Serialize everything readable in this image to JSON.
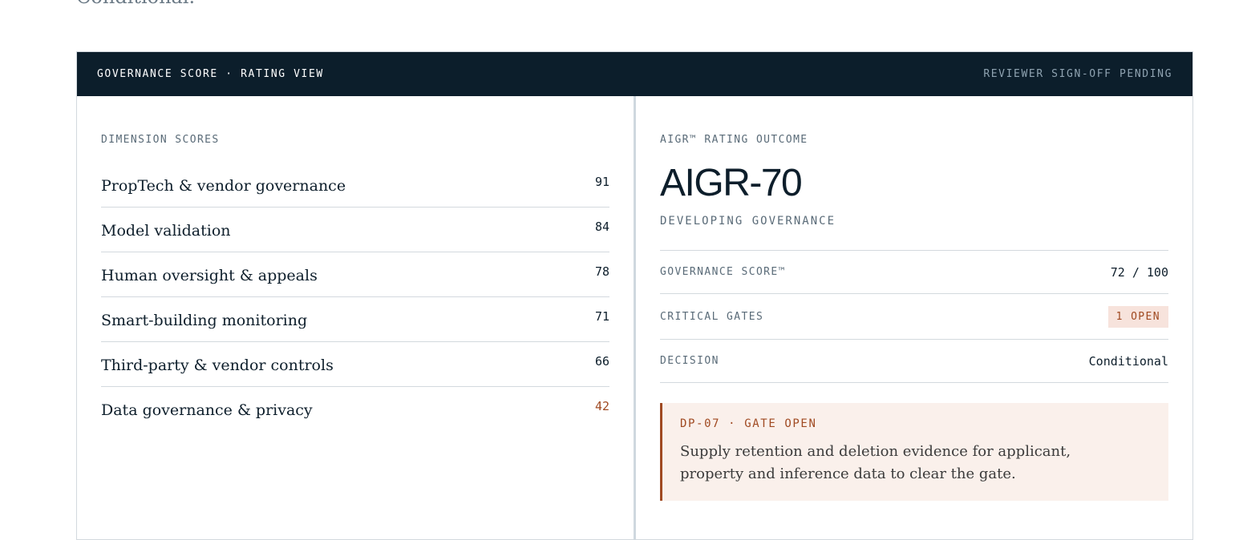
{
  "previous": {
    "text": "Conditional."
  },
  "header": {
    "title": "GOVERNANCE SCORE · RATING VIEW",
    "status": "REVIEWER SIGN-OFF PENDING"
  },
  "dimensions": {
    "heading": "DIMENSION SCORES",
    "items": [
      {
        "label": "PropTech & vendor governance",
        "score": "91"
      },
      {
        "label": "Model validation",
        "score": "84"
      },
      {
        "label": "Human oversight & appeals",
        "score": "78"
      },
      {
        "label": "Smart-building monitoring",
        "score": "71"
      },
      {
        "label": "Third-party & vendor controls",
        "score": "66"
      },
      {
        "label": "Data governance & privacy",
        "score": "42"
      }
    ]
  },
  "outcome": {
    "heading": "AIGR™ RATING OUTCOME",
    "rating": "AIGR-70",
    "level": "DEVELOPING GOVERNANCE",
    "rows": [
      {
        "key": "GOVERNANCE SCORE™",
        "value": "72 / 100"
      },
      {
        "key": "CRITICAL GATES",
        "value": "1 OPEN"
      },
      {
        "key": "DECISION",
        "value": "Conditional"
      }
    ],
    "alert": {
      "title": "DP-07 · GATE OPEN",
      "body": "Supply retention and deletion evidence for applicant, property and inference data to clear the gate."
    }
  },
  "colors": {
    "header_bg": "#0c1e2b",
    "accent_warning": "#a04a22",
    "pill_bg": "#f7e3dc",
    "alert_bg": "#faf0eb"
  }
}
